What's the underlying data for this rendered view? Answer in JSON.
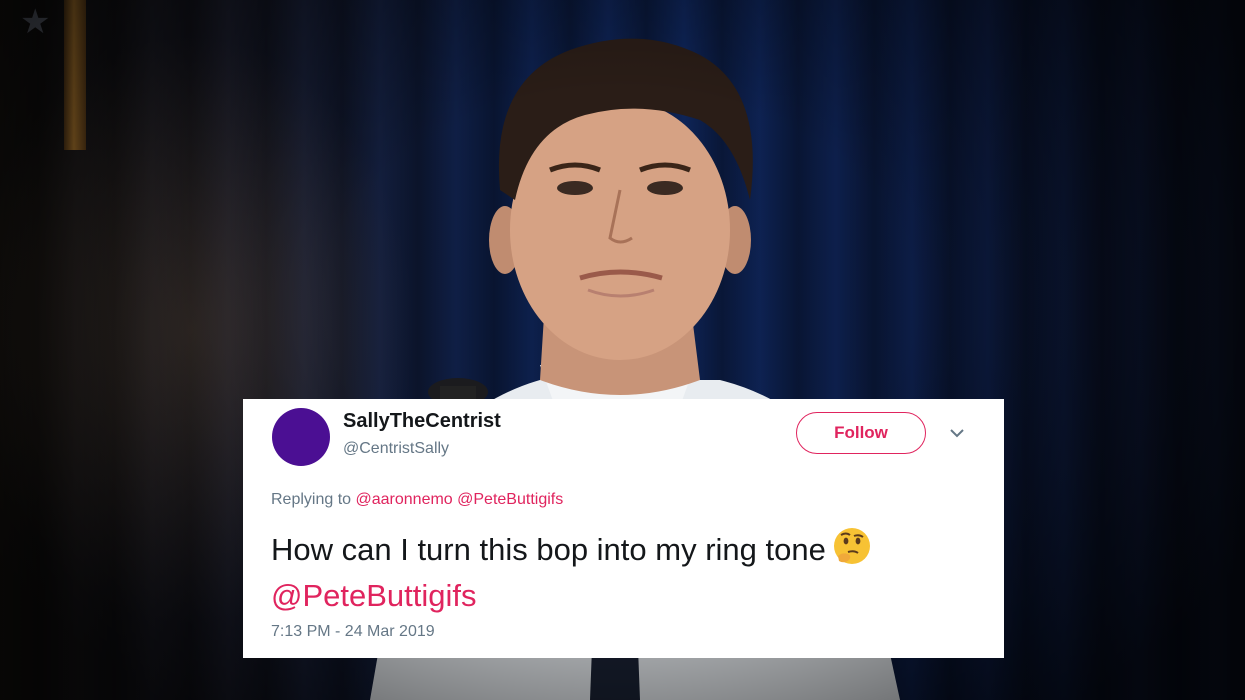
{
  "tweet": {
    "display_name": "SallyTheCentrist",
    "handle": "@CentristSally",
    "follow_label": "Follow",
    "replying_prefix": "Replying to",
    "reply_mentions": [
      "@aaronnemo",
      "@PeteButtigifs"
    ],
    "text": "How can I turn this bop into my ring tone",
    "emoji": "thinking-face-icon",
    "text_mention": "@PeteButtigifs",
    "timestamp": "7:13 PM - 24 Mar 2019"
  },
  "colors": {
    "accent": "#e0245e",
    "avatar": "#4b0f93",
    "secondary_text": "#657786",
    "primary_text": "#14171a"
  }
}
